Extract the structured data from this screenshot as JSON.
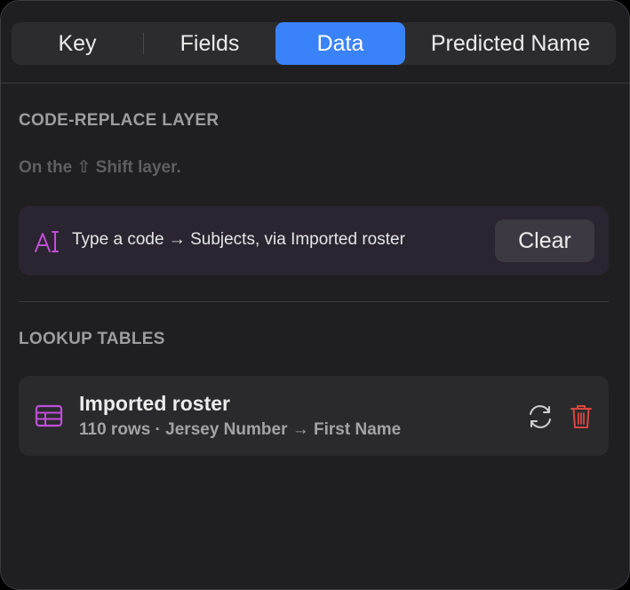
{
  "tabs": [
    {
      "label": "Key",
      "active": false
    },
    {
      "label": "Fields",
      "active": false
    },
    {
      "label": "Data",
      "active": true
    },
    {
      "label": "Predicted Name",
      "active": false
    }
  ],
  "code_replace": {
    "section_title": "CODE-REPLACE LAYER",
    "hint": "On the ⇧ Shift layer.",
    "row_icon": "text-cursor-icon",
    "row_text": "Type a code → Subjects, via Imported roster",
    "clear_label": "Clear"
  },
  "lookup": {
    "section_title": "LOOKUP TABLES",
    "tables": [
      {
        "icon": "table-icon",
        "name": "Imported roster",
        "meta": "110 rows · Jersey Number → First Name"
      }
    ]
  },
  "colors": {
    "accent": "#3a82f7",
    "code_icon": "#c04fd8",
    "table_icon": "#c04fd8",
    "delete": "#d9473f"
  }
}
